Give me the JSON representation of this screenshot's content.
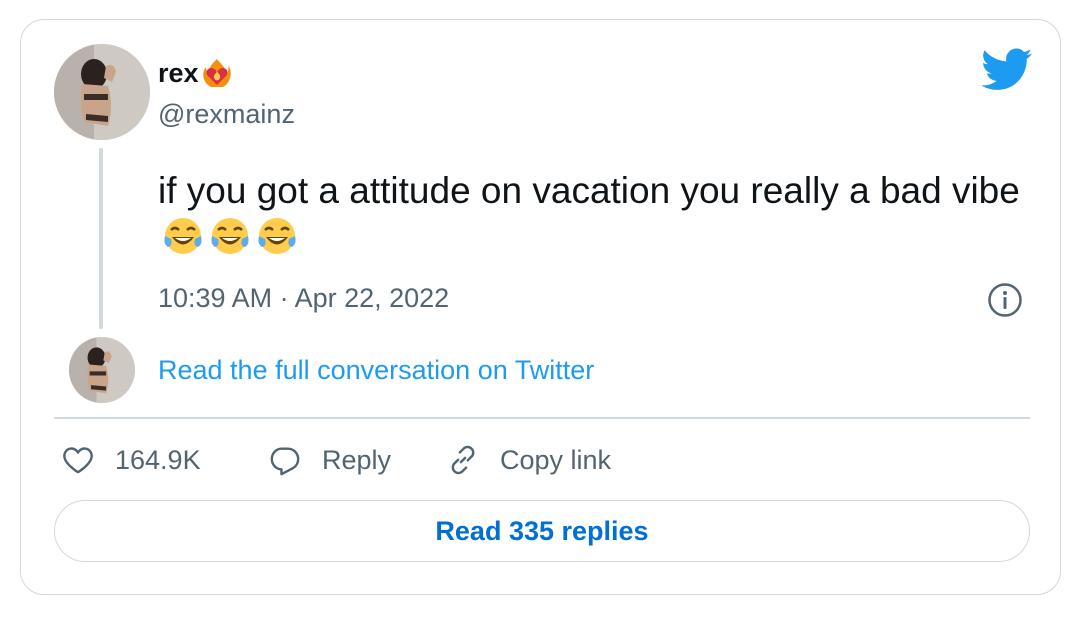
{
  "author": {
    "display_name": "rex",
    "name_emoji": "heart-on-fire-emoji",
    "handle": "@rexmainz"
  },
  "tweet": {
    "text": "if you got a attitude on vacation you really a bad vibe",
    "emojis": [
      "face-with-tears-of-joy",
      "face-with-tears-of-joy",
      "face-with-tears-of-joy"
    ],
    "timestamp": "10:39 AM · Apr 22, 2022"
  },
  "conversation_link": "Read the full conversation on Twitter",
  "actions": {
    "like_count": "164.9K",
    "reply_label": "Reply",
    "copy_label": "Copy link"
  },
  "read_replies_label": "Read 335 replies",
  "colors": {
    "brand_blue": "#1d9bf0",
    "link_blue": "#006fd6",
    "secondary_text": "#536471",
    "border": "#cfd9de"
  },
  "icons": [
    "twitter-bird-icon",
    "info-icon",
    "heart-icon",
    "reply-bubble-icon",
    "link-icon"
  ]
}
